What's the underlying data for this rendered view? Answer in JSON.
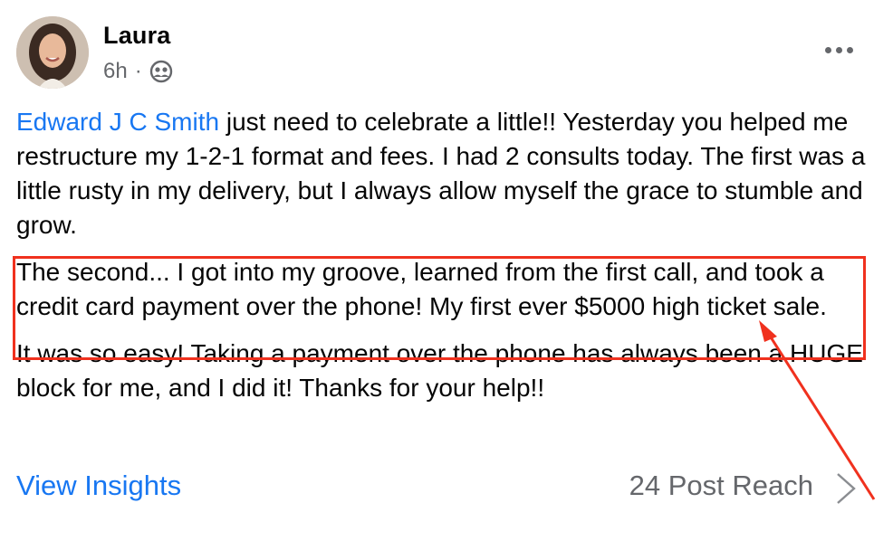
{
  "post": {
    "author": "Laura",
    "time": "6h",
    "separator": "·",
    "audience_icon": "friends-icon",
    "more_icon": "more-options-icon",
    "mention": "Edward J C Smith",
    "paragraph1_rest": " just need to celebrate a little!! Yesterday you helped me restructure my 1-2-1 format and fees. I had 2 consults today. The first was a little rusty in my delivery, but I always allow myself the grace to stumble and grow.",
    "paragraph2": "The second... I got into my groove, learned from the first call, and took a credit card payment over the phone! My first ever $5000 high ticket sale.",
    "paragraph3": "It was so easy! Taking a payment over the phone has always been a HUGE block for me, and I did it! Thanks for your help!!"
  },
  "footer": {
    "insights_label": "View Insights",
    "reach_label": "24 Post Reach",
    "chevron_icon": "chevron-right-icon"
  },
  "colors": {
    "mention": "#1877f2",
    "annotation": "#f0311e",
    "secondary_text": "#65676b"
  }
}
